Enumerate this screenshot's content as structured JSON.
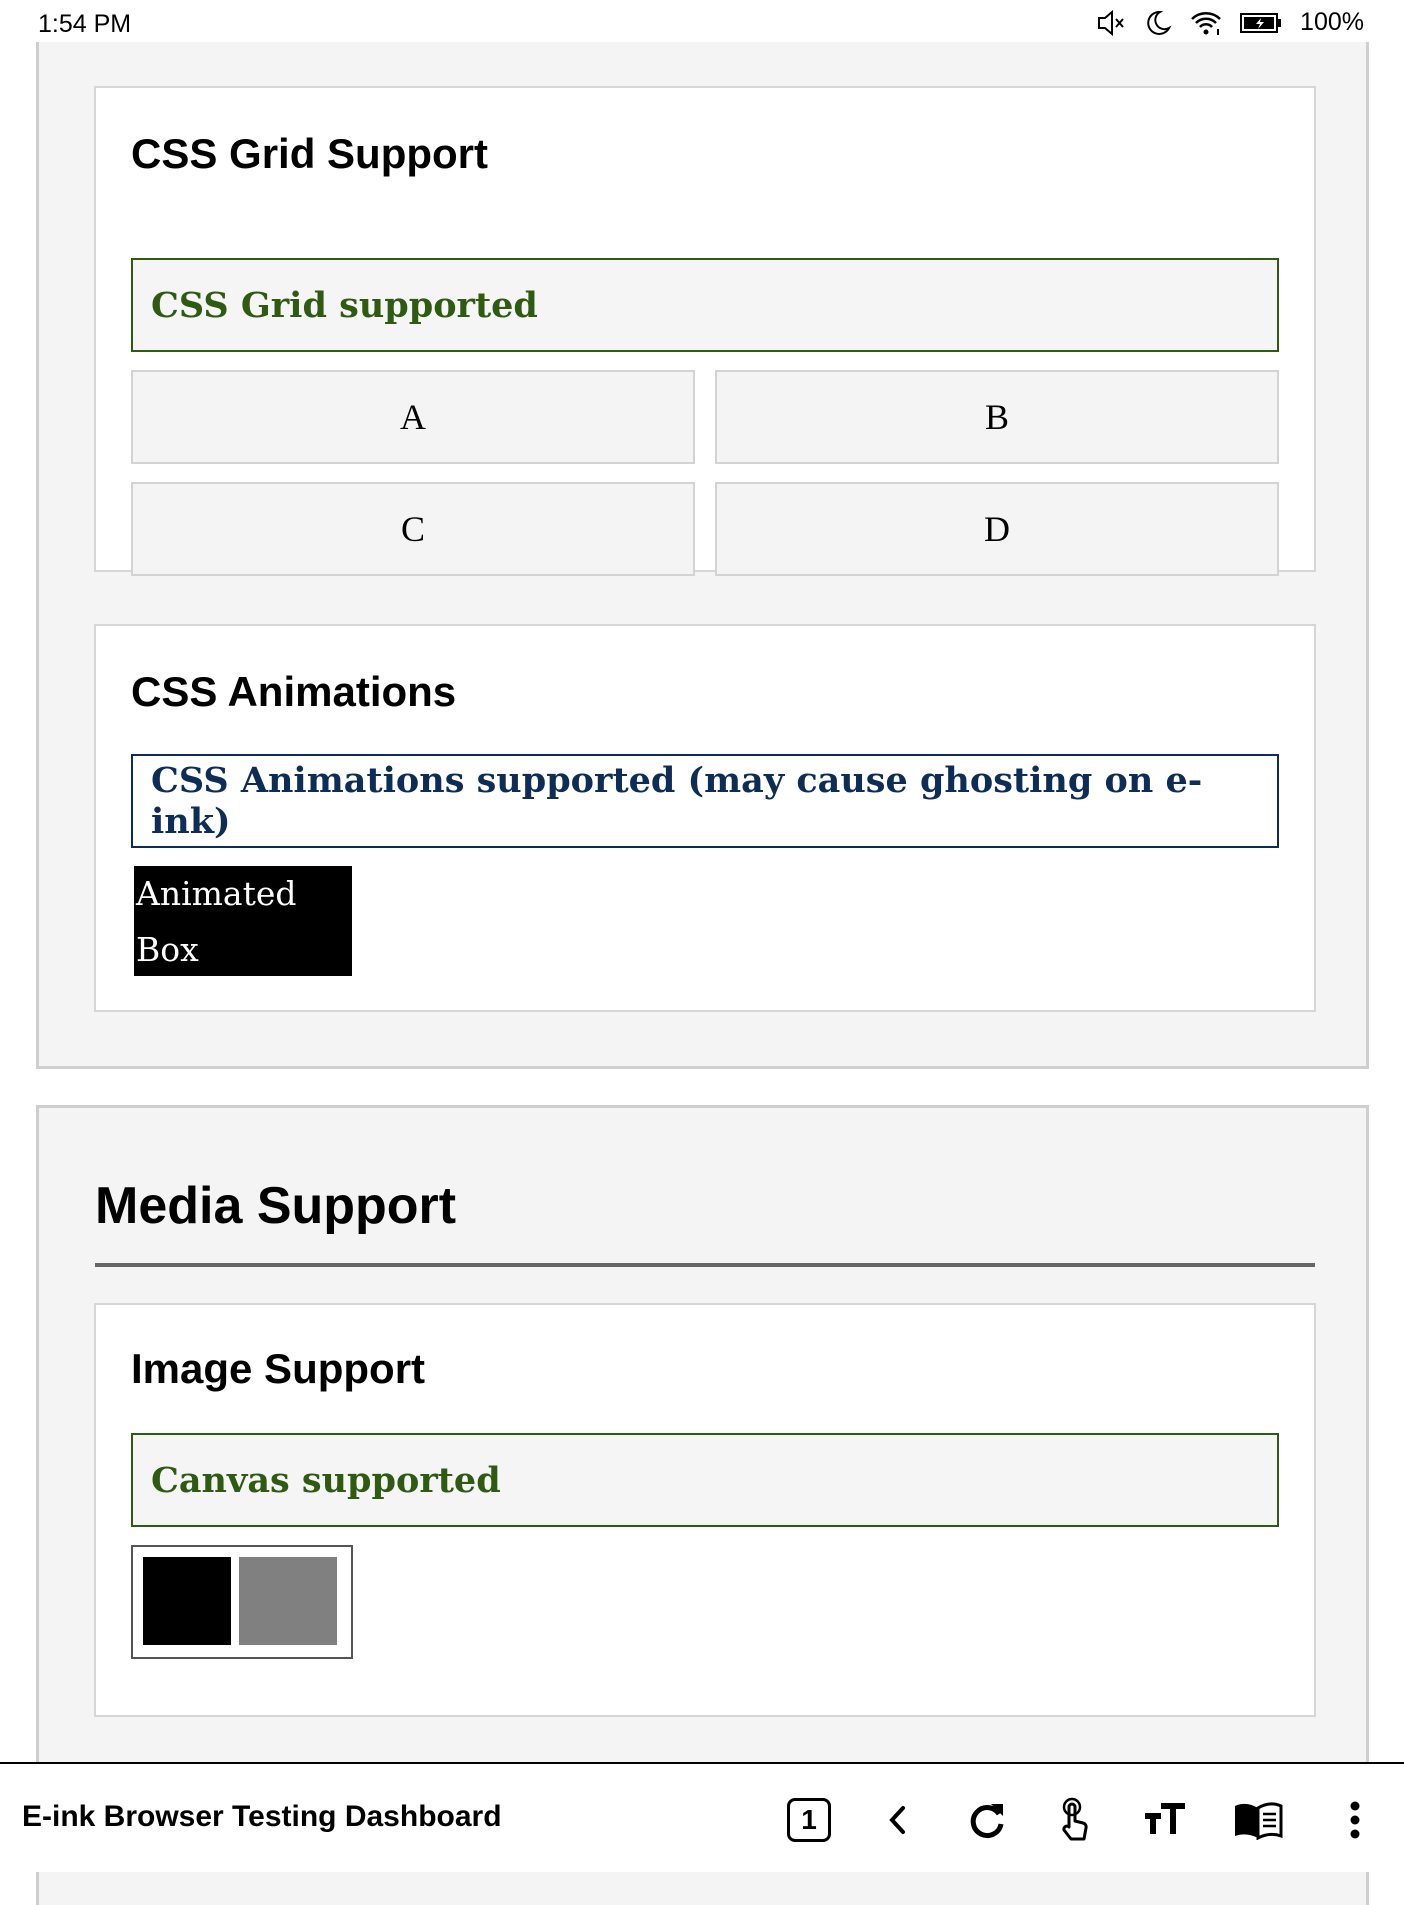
{
  "status_bar": {
    "time": "1:54 PM",
    "battery": "100%"
  },
  "css_grid": {
    "title": "CSS Grid Support",
    "notice": "CSS Grid supported",
    "cells": [
      "A",
      "B",
      "C",
      "D"
    ]
  },
  "css_animations": {
    "title": "CSS Animations",
    "notice": "CSS Animations supported (may cause ghosting on e-ink)",
    "box_line1": "Animated",
    "box_line2": "Box"
  },
  "media": {
    "title": "Media Support",
    "image_support": {
      "title": "Image Support",
      "notice": "Canvas supported"
    }
  },
  "toolbar": {
    "page_title": "E-ink Browser Testing Dashboard",
    "tab_count": "1"
  },
  "colors": {
    "success": "#2e5a12",
    "info": "#0d2d57"
  }
}
